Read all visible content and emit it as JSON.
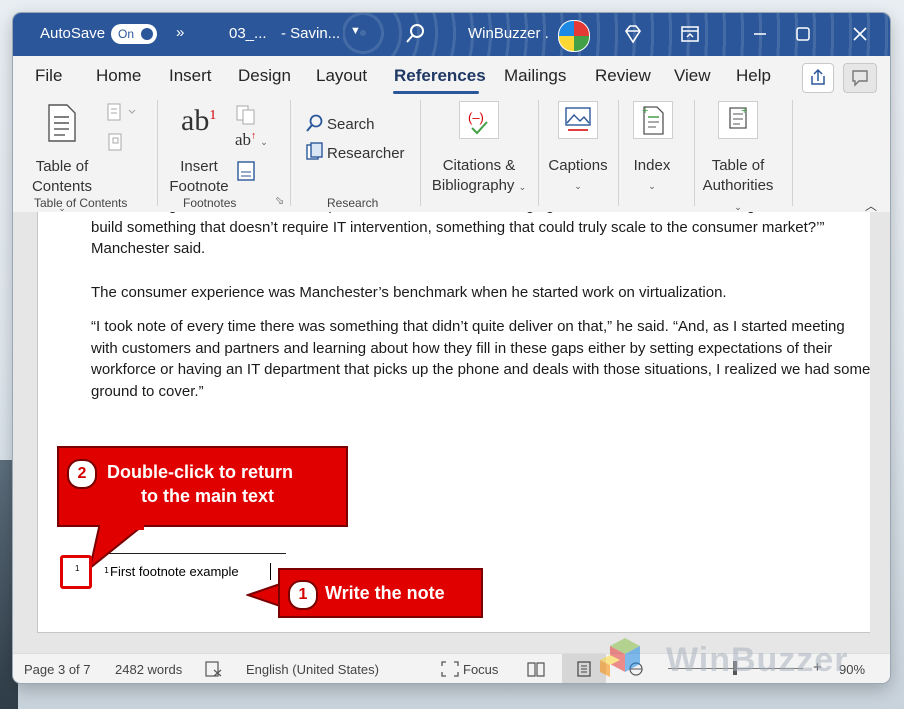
{
  "titlebar": {
    "autosave_label": "AutoSave",
    "autosave_state": "On",
    "more_glyph": "»",
    "doc_name": "03_...",
    "save_status": "- Savin...",
    "user_name": "WinBuzzer .",
    "icons": [
      "search-icon",
      "diamond-icon",
      "restore-window-icon",
      "minimize-icon",
      "maximize-icon",
      "close-icon"
    ]
  },
  "menu": {
    "tabs": [
      "File",
      "Home",
      "Insert",
      "Design",
      "Layout",
      "References",
      "Mailings",
      "Review",
      "View",
      "Help"
    ],
    "active_tab": "References"
  },
  "ribbon": {
    "toc": {
      "button": [
        "Table of",
        "Contents"
      ],
      "group": "Table of Contents"
    },
    "footnotes": {
      "icon_text": "ab",
      "superscript": "1",
      "button": [
        "Insert",
        "Footnote"
      ],
      "group": "Footnotes"
    },
    "research": {
      "search": "Search",
      "researcher": "Researcher",
      "group": "Research"
    },
    "citations": [
      "Citations &",
      "Bibliography"
    ],
    "captions": "Captions",
    "index": "Index",
    "authorities": [
      "Table of",
      "Authorities"
    ]
  },
  "document": {
    "paragraphs": [
      "audience – gamers – lacks an IT department to lean on when things glitch. “That started me thinking, ‘How do we build something that doesn’t require IT intervention, something that could truly scale to the consumer market?’” Manchester said.",
      "The consumer experience was Manchester’s benchmark when he started work on virtualization.",
      "“I took note of every time there was something that didn’t quite deliver on that,” he said. “And, as I started meeting with customers and partners and learning about how they fill in these gaps either by setting expectations of their workforce or having an IT department that picks up the phone and deals with those situations, I realized we had some ground to cover.”"
    ],
    "footnote_number": "1",
    "footnote_text": "First footnote example"
  },
  "callouts": {
    "step1": {
      "number": "1",
      "text": "Write the note"
    },
    "step2": {
      "number": "2",
      "text_line1": "Double-click to return",
      "text_line2": "to the main text"
    },
    "color": "#e10000"
  },
  "statusbar": {
    "page": "Page 3 of 7",
    "words": "2482 words",
    "language": "English (United States)",
    "focus": "Focus",
    "zoom": "90%",
    "zoom_plus": "+"
  },
  "watermark": "WinBuzzer",
  "colors": {
    "word_blue": "#2b579a",
    "accent_red": "#e10000"
  }
}
